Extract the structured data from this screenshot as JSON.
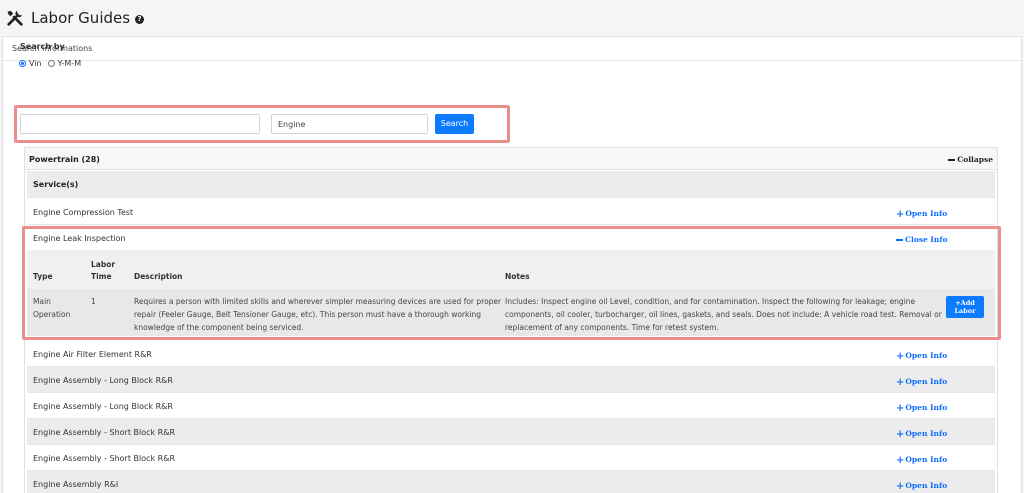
{
  "header": {
    "title": "Labor Guides",
    "help_glyph": "?"
  },
  "card": {
    "title": "Search informations"
  },
  "search": {
    "by_label": "Search by",
    "options": [
      "Vin",
      "Y-M-M"
    ],
    "selected": "Vin",
    "vin_value": "",
    "term_value": "Engine",
    "button_label": "Search"
  },
  "group": {
    "title": "Powertrain (28)",
    "collapse_label": "Collapse",
    "services_label": "Service(s)",
    "open_label": "Open Info",
    "close_label": "Close Info",
    "items": [
      "Engine Compression Test",
      "Engine Leak Inspection",
      "Engine Air Filter Element R&R",
      "Engine Assembly - Long Block R&R",
      "Engine Assembly - Long Block R&R",
      "Engine Assembly - Short Block R&R",
      "Engine Assembly - Short Block R&R",
      "Engine Assembly R&I"
    ]
  },
  "detail": {
    "headers": {
      "type": "Type",
      "labor_time_1": "Labor",
      "labor_time_2": "Time",
      "description": "Description",
      "notes": "Notes"
    },
    "row": {
      "type_1": "Main",
      "type_2": "Operation",
      "labor_time": "1",
      "description_1": "Requires a person with limited skills and wherever simpler measuring devices are used for proper",
      "description_2": "repair (Feeler Gauge, Belt Tensioner Gauge, etc). This person must have a thorough working",
      "description_3": "knowledge of the component being serviced.",
      "notes_1": "Includes: Inspect engine oil Level, condition, and for contamination. Inspect the following for leakage; engine",
      "notes_2": "components, oil cooler, turbocharger, oil lines, gaskets, and seals. Does not include: A vehicle road test. Removal or",
      "notes_3": "replacement of any components. Time for retest system.",
      "add_label_1": "Add",
      "add_label_2": "Labor"
    }
  },
  "colors": {
    "accent": "#0d7bff",
    "highlight": "#ec8e8e"
  }
}
